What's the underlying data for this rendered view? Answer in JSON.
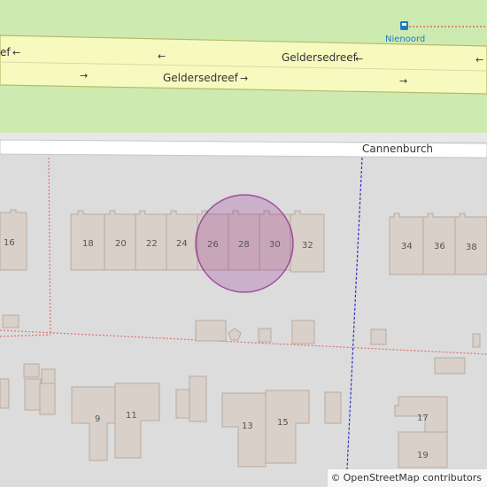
{
  "map": {
    "road_labels": {
      "top_left": "ef",
      "top_right": "Geldersedreef",
      "bottom": "Geldersedreef",
      "street": "Cannenburch"
    },
    "bus_stop": "Nienoord",
    "house_numbers": [
      "16",
      "18",
      "20",
      "22",
      "24",
      "26",
      "28",
      "30",
      "32",
      "34",
      "36",
      "38",
      "9",
      "11",
      "13",
      "15",
      "17",
      "19"
    ],
    "highlight_color": "#800080"
  },
  "attribution": {
    "symbol": "©",
    "text": "OpenStreetMap contributors"
  }
}
